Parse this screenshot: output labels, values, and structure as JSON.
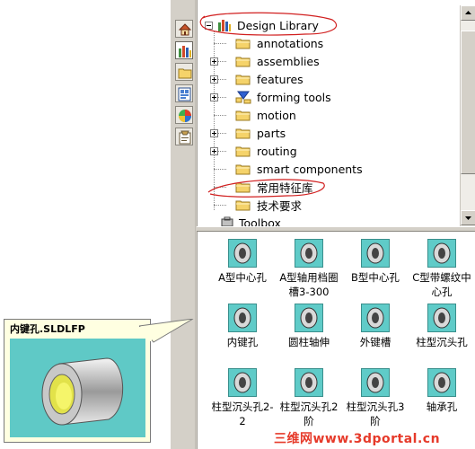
{
  "side_tabs": [
    {
      "icon": "home-icon"
    },
    {
      "icon": "design-library-icon",
      "active": true
    },
    {
      "icon": "file-explorer-icon"
    },
    {
      "icon": "view-palette-icon"
    },
    {
      "icon": "appearances-icon"
    },
    {
      "icon": "custom-properties-icon"
    }
  ],
  "tree": {
    "root_label": "Design Library",
    "items": [
      {
        "label": "annotations",
        "expandable": false
      },
      {
        "label": "assemblies",
        "expandable": true
      },
      {
        "label": "features",
        "expandable": true
      },
      {
        "label": "forming tools",
        "expandable": true,
        "icon": "forming-tools-icon"
      },
      {
        "label": "motion",
        "expandable": false
      },
      {
        "label": "parts",
        "expandable": true
      },
      {
        "label": "routing",
        "expandable": true
      },
      {
        "label": "smart components",
        "expandable": false
      },
      {
        "label": "常用特征库",
        "expandable": false
      },
      {
        "label": "技术要求",
        "expandable": false
      }
    ],
    "toolbox_label": "Toolbox"
  },
  "grid_items": [
    {
      "label": "A型中心孔",
      "icon": "center-hole-a-icon"
    },
    {
      "label": "A型轴用档圈槽3-300",
      "icon": "retaining-ring-groove-icon"
    },
    {
      "label": "B型中心孔",
      "icon": "center-hole-b-icon"
    },
    {
      "label": "C型带螺纹中心孔",
      "icon": "center-hole-c-icon"
    },
    {
      "label": "内键孔",
      "icon": "keyway-bore-icon"
    },
    {
      "label": "圆柱轴伸",
      "icon": "cylindrical-shaft-end-icon"
    },
    {
      "label": "外键槽",
      "icon": "external-keyway-icon"
    },
    {
      "label": "柱型沉头孔",
      "icon": "counterbore-icon"
    },
    {
      "label": "柱型沉头孔2-2",
      "icon": "counterbore-2-2-icon"
    },
    {
      "label": "柱型沉头孔2阶",
      "icon": "counterbore-2-step-icon"
    },
    {
      "label": "柱型沉头孔3阶",
      "icon": "counterbore-3-step-icon"
    },
    {
      "label": "轴承孔",
      "icon": "bearing-hole-icon"
    }
  ],
  "tooltip": {
    "title": "内键孔.SLDLFP"
  },
  "watermark": "三维网www.3dportal.cn",
  "colors": {
    "icon_bg": "#5fcbc8",
    "annotation_red": "#d11f1f",
    "watermark_red": "#e63a2a",
    "tooltip_bg": "#ffffe1"
  }
}
